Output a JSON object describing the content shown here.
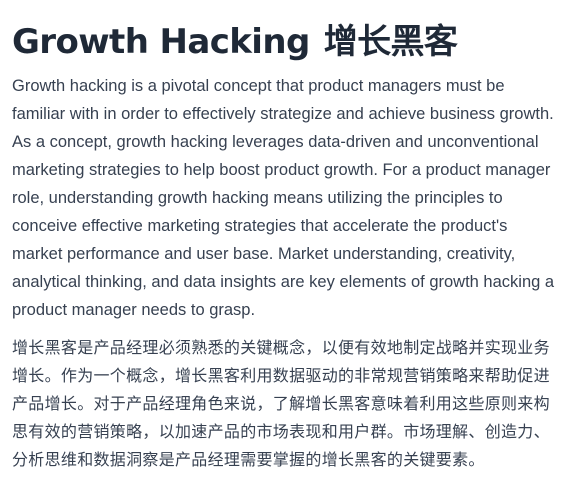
{
  "article": {
    "title_en": "Growth Hacking",
    "title_zh": "增长黑客",
    "paragraph_en": "Growth hacking is a pivotal concept that product managers must be familiar with in order to effectively strategize and achieve business growth. As a concept, growth hacking leverages data-driven and unconventional marketing strategies to help boost product growth. For a product manager role, understanding growth hacking means utilizing the principles to conceive effective marketing strategies that accelerate the product's market performance and user base. Market understanding, creativity, analytical thinking, and data insights are key elements of growth hacking a product manager needs to grasp.",
    "paragraph_zh": "增长黑客是产品经理必须熟悉的关键概念，以便有效地制定战略并实现业务增长。作为一个概念，增长黑客利用数据驱动的非常规营销策略来帮助促进产品增长。对于产品经理角色来说，了解增长黑客意味着利用这些原则来构思有效的营销策略，以加速产品的市场表现和用户群。市场理解、创造力、分析思维和数据洞察是产品经理需要掌握的增长黑客的关键要素。"
  }
}
